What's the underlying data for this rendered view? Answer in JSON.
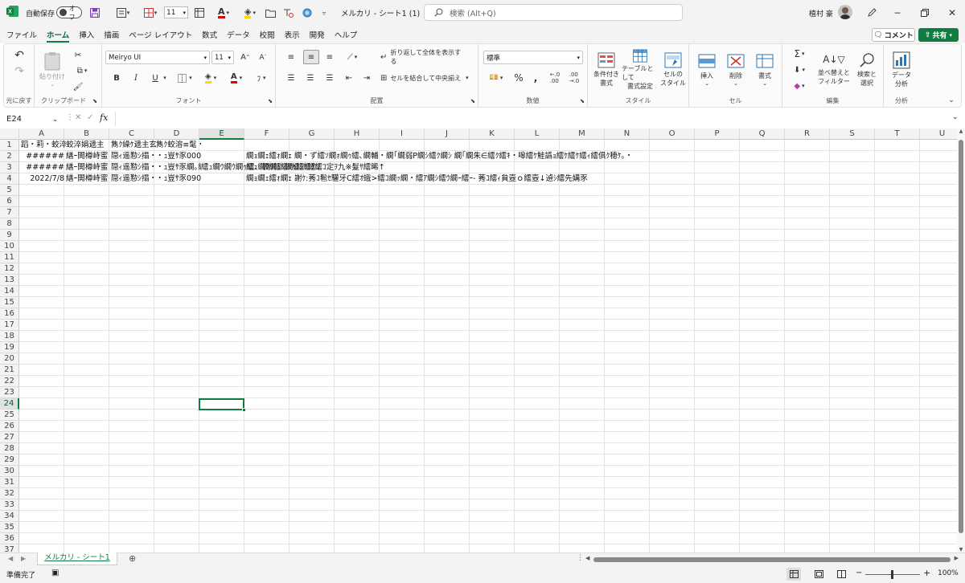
{
  "titlebar": {
    "autosave_label": "自動保存",
    "autosave_state": "オフ",
    "font_size": "11",
    "doc_title": "メルカリ - シート1 (1)",
    "search_placeholder": "検索 (Alt+Q)",
    "user_name": "植村 豪"
  },
  "menu": [
    "ファイル",
    "ホーム",
    "挿入",
    "描画",
    "ページ レイアウト",
    "数式",
    "データ",
    "校閲",
    "表示",
    "開発",
    "ヘルプ"
  ],
  "menu_active_index": 1,
  "comment_button": "コメント",
  "share_button": "共有",
  "ribbon": {
    "undo_group": "元に戻す",
    "clipboard": {
      "paste": "貼り付け",
      "label": "クリップボード"
    },
    "font": {
      "name": "Meiryo UI",
      "size": "11",
      "label": "フォント",
      "bold": "B",
      "italic": "I",
      "underline": "U"
    },
    "alignment": {
      "wrap": "折り返して全体を表示する",
      "merge": "セルを結合して中央揃え",
      "label": "配置"
    },
    "number": {
      "format": "標準",
      "label": "数値"
    },
    "styles": {
      "conditional": [
        "条件付き",
        "書式"
      ],
      "table": [
        "テーブルとして",
        "書式設定"
      ],
      "cell": [
        "セルの",
        "スタイル"
      ],
      "label": "スタイル"
    },
    "cells": {
      "insert": "挿入",
      "delete": "削除",
      "format": "書式",
      "label": "セル"
    },
    "editing": {
      "sort": [
        "並べ替えと",
        "フィルター"
      ],
      "find": [
        "検索と",
        "選択"
      ],
      "label": "編集"
    },
    "analysis": {
      "data": [
        "データ",
        "分析"
      ],
      "label": "分析"
    }
  },
  "formula_bar": {
    "name_box": "E24",
    "fx": "fx",
    "value": ""
  },
  "columns": [
    "A",
    "B",
    "C",
    "D",
    "E",
    "F",
    "G",
    "H",
    "I",
    "J",
    "K",
    "L",
    "M",
    "N",
    "O",
    "P",
    "Q",
    "R",
    "S",
    "T",
    "U"
  ],
  "selected_column": "E",
  "rows_count": 37,
  "selected_row": 24,
  "cells": {
    "r1": {
      "A": "蹈・莉・蛟淬ｷ",
      "B": "蛟淬娟遞主",
      "C": "雋ｸ繰ｹ遞主玄蛻・",
      "D": "雋ｸ蛟溶≡髦・鐚倩ｱ・"
    },
    "r2": {
      "A": "######",
      "B": "繕ｰ閧樽峙蜜",
      "C": "隠ｨ遥懃ｼ搨・莠区",
      "D": "・ｭ豈ｻ豕000\"",
      "F": "繝ｮ繝ｪ繧ｫ繝ｪ 繝・ず繧ｿ繝ｫ繝ｩ繧､繝輔・繝｢繝弱Ρ繝ｼ繧ｸ繝ｼ 繝｢繝朱∈繧ｸ繧ｷ・嗥繧ｹ鮭譌ｮ繧ｹ繧ｹ繧ｨ繧俱ｸ穂ｹ｡・"
    },
    "r3": {
      "A": "######",
      "B": "繕ｰ閧樽峙蜜",
      "C": "隠ｨ遥懃ｼ搨・莠区",
      "D": "・ｭ豈ｻ豕繝｡繝ｪ繧ｫ繝ｪ",
      "E": "繧ｭ繝ｳ繝ｳ繝ｩ繧、繝ｳ繧ｼ繝ｩ繧ｹ繧ｺ",
      "F": "繧ｭ繝ｳ繝ｩ繧ｹ繧ｼ繧ｹ繧ｺ定ｦ九※髮ｻ繧晞↑"
    },
    "r4": {
      "A": "2022/7/8",
      "B": "繕ｰ閧樽峙蜜",
      "C": "隠ｨ遥懃ｼ搨・莠区",
      "D": "・ｭ豈ｻ豕090\"",
      "F": "繝ｮ繝ｪ繧ｫ繝ｪ 謝ｹ:莠ｺ髱ｾ驩牙C繧ｵ蛾>繧ｺ繝ｯ繝・繧ｱ繝ｼ繧ｳ繝ｰ繧ｰ- 莠ｺ繧ｨ貟壼ｏ繧壼↓遉ｼ繧先媾豕"
    }
  },
  "sheet_tab": "メルカリ - シート1 (1)",
  "status": {
    "ready": "準備完了",
    "zoom": "100%"
  }
}
